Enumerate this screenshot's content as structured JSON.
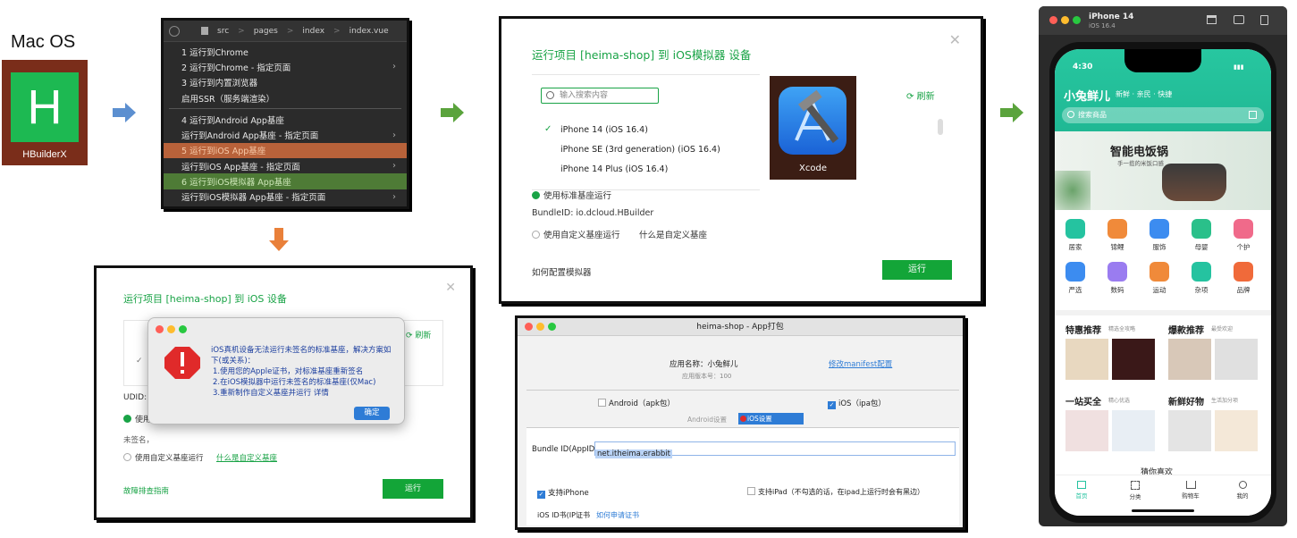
{
  "mac": {
    "label": "Mac OS",
    "logo_caption": "HBuilderX"
  },
  "menu": {
    "breadcrumb": [
      "src",
      "pages",
      "index",
      "index.vue"
    ],
    "items": [
      {
        "label": "1 运行到Chrome",
        "chev": false
      },
      {
        "label": "2 运行到Chrome - 指定页面",
        "chev": true
      },
      {
        "label": "3 运行到内置浏览器",
        "chev": false
      },
      {
        "label": "启用SSR（服务端渲染）",
        "chev": false
      },
      {
        "label": "4 运行到Android App基座",
        "chev": false
      },
      {
        "label": "运行到Android App基座 - 指定页面",
        "chev": true
      },
      {
        "label": "5 运行到iOS App基座",
        "chev": false
      },
      {
        "label": "运行到iOS App基座 - 指定页面",
        "chev": true
      },
      {
        "label": "6 运行到iOS模拟器 App基座",
        "chev": false
      },
      {
        "label": "运行到iOS模拟器 App基座 - 指定页面",
        "chev": true
      }
    ]
  },
  "sim": {
    "title": "运行项目 [heima-shop] 到 iOS模拟器 设备",
    "search_placeholder": "输入搜索内容",
    "devices": [
      "iPhone 14 (iOS 16.4)",
      "iPhone SE (3rd generation) (iOS 16.4)",
      "iPhone 14 Plus (iOS 16.4)"
    ],
    "xcode_label": "Xcode",
    "refresh": "刷新",
    "std_base": "使用标准基座运行",
    "bundle": "BundleID:  io.dcloud.HBuilder",
    "custom_base": "使用自定义基座运行",
    "what_custom": "什么是自定义基座",
    "how_config": "如何配置模拟器",
    "run": "运行"
  },
  "iosdev": {
    "title": "运行项目 [heima-shop] 到 iOS 设备",
    "refresh": "刷新",
    "udid": "UDID: (",
    "use": "使用",
    "unsigned": "未签名，",
    "custom_base": "使用自定义基座运行",
    "what_custom": "什么是自定义基座",
    "help": "故障排查指南",
    "run": "运行"
  },
  "alert": {
    "lines": [
      "iOS真机设备无法运行未签名的标准基座，解决方案如下(或关系)：",
      "1.使用您的Apple证书，对标准基座重新签名",
      "2.在iOS模拟器中运行未签名的标准基座(仅Mac)",
      "3.重新制作自定义基座并运行 详情"
    ],
    "ok": "确定"
  },
  "pack": {
    "title": "heima-shop - App打包",
    "app_name": "应用名称：小兔鲜儿",
    "app_version": "应用版本号：100",
    "manifest": "修改manifest配置",
    "android": "Android（apk包）",
    "ios": "iOS（ipa包）",
    "tab_android": "Android设置",
    "tab_ios": "iOS设置",
    "bundle_label": "Bundle ID(AppID)",
    "bundle_value": "net.itheima.erabbit",
    "iphone": "支持iPhone",
    "ipad": "支持iPad（不勾选的话，在ipad上运行时会有黑边）",
    "cert": "iOS ID书(IP证书",
    "how_cert": "如何申请证书"
  },
  "phone": {
    "model": "iPhone 14",
    "os": "iOS 16.4",
    "time": "4:30",
    "brand": "小兔鲜儿",
    "slogan": "新鲜 · 亲民 · 快捷",
    "search": "搜索商品",
    "banner_title": "智能电饭锅",
    "banner_sub": "手一揽的米饭口感",
    "cats": [
      "居家",
      "锦鲤",
      "服饰",
      "母婴",
      "个护",
      "严选",
      "数码",
      "运动",
      "杂项",
      "品牌"
    ],
    "sections": [
      {
        "title": "特惠推荐",
        "sub": "精选全攻略"
      },
      {
        "title": "爆款推荐",
        "sub": "最受欢迎"
      },
      {
        "title": "一站买全",
        "sub": "精心优选"
      },
      {
        "title": "新鲜好物",
        "sub": "生活加分项"
      }
    ],
    "guess": "猜你喜欢",
    "tabs": [
      "首页",
      "分类",
      "购物车",
      "我的"
    ],
    "colors": [
      "#25c3a0",
      "#f08a3a",
      "#3c8cf0",
      "#2ac08a",
      "#f06a8a",
      "#3c8cf0",
      "#9a7cf0",
      "#f08a3a",
      "#25c3a0",
      "#f06a3a"
    ]
  }
}
